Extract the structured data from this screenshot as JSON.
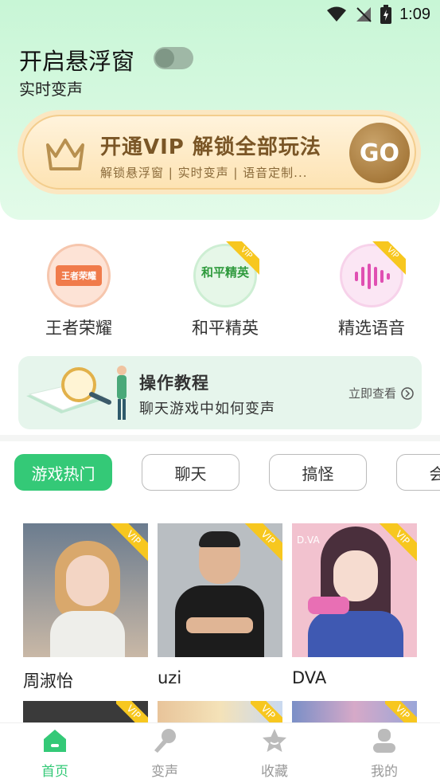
{
  "status": {
    "time": "1:09"
  },
  "floating": {
    "title": "开启悬浮窗",
    "subtitle": "实时变声",
    "enabled": false
  },
  "vip_banner": {
    "title": "开通VIP 解锁全部玩法",
    "desc": "解锁悬浮窗 | 实时变声 | 语音定制...",
    "go": "GO"
  },
  "categories": [
    {
      "label": "王者荣耀",
      "logo_text": "王者荣耀",
      "vip": false
    },
    {
      "label": "和平精英",
      "logo_text": "和平精英",
      "vip": true,
      "vip_text": "VIP"
    },
    {
      "label": "精选语音",
      "vip": true,
      "vip_text": "VIP"
    }
  ],
  "tutorial": {
    "title": "操作教程",
    "subtitle": "聊天游戏中如何变声",
    "link": "立即查看"
  },
  "tabs": [
    {
      "label": "游戏热门",
      "active": true
    },
    {
      "label": "聊天",
      "active": false
    },
    {
      "label": "搞怪",
      "active": false
    },
    {
      "label": "会员",
      "active": false
    }
  ],
  "cards": [
    {
      "name": "周淑怡",
      "vip": "VIP"
    },
    {
      "name": "uzi",
      "vip": "VIP"
    },
    {
      "name": "DVA",
      "vip": "VIP",
      "overlay": "D.VA"
    }
  ],
  "nav": [
    {
      "label": "首页",
      "icon": "home-icon",
      "active": true
    },
    {
      "label": "变声",
      "icon": "microphone-icon",
      "active": false
    },
    {
      "label": "收藏",
      "icon": "star-icon",
      "active": false
    },
    {
      "label": "我的",
      "icon": "user-icon",
      "active": false
    }
  ],
  "colors": {
    "accent": "#34c977",
    "vip_gold": "#f7c71f",
    "banner_brown": "#7a5626"
  }
}
